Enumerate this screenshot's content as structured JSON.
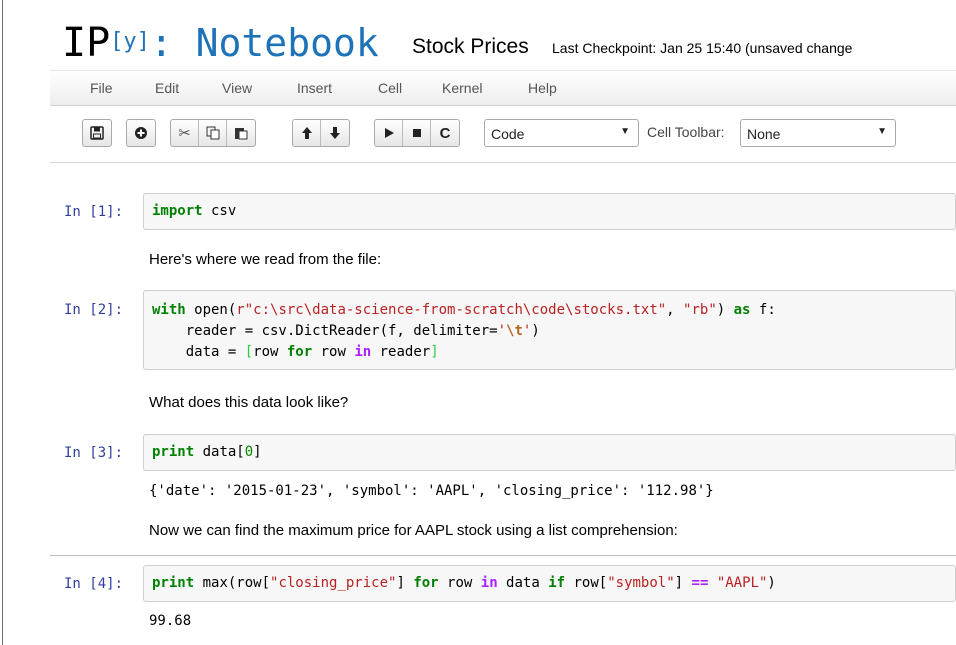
{
  "header": {
    "logo_ip": "IP",
    "logo_y": "[y]",
    "logo_rest": ": Notebook",
    "notebook_title": "Stock Prices",
    "checkpoint": "Last Checkpoint: Jan 25 15:40 (unsaved change"
  },
  "menu": [
    "File",
    "Edit",
    "View",
    "Insert",
    "Cell",
    "Kernel",
    "Help"
  ],
  "toolbar": {
    "icons": [
      "save-icon",
      "plus-icon",
      "cut-icon",
      "copy-icon",
      "paste-icon",
      "arrow-up-icon",
      "arrow-down-icon",
      "play-icon",
      "stop-icon",
      "restart-icon"
    ],
    "cell_type": "Code",
    "cell_toolbar_label": "Cell Toolbar:",
    "cell_toolbar_value": "None"
  },
  "cells": {
    "c1": {
      "prompt": "In [1]:",
      "kw": "import",
      "rest": " csv"
    },
    "md1": "Here's where we read from the file:",
    "c2": {
      "prompt": "In [2]:",
      "l1_with": "with",
      "l1_open": " open(",
      "l1_r": "r",
      "l1_path": "\"c:\\src\\data-science-from-scratch\\code\\stocks.txt\"",
      "l1_comma": ", ",
      "l1_rb": "\"rb\"",
      "l1_close": ") ",
      "l1_as": "as",
      "l1_f": " f:",
      "l2_a": "    reader = csv.DictReader(f, delimiter=",
      "l2_q1": "'",
      "l2_esc": "\\t",
      "l2_q2": "'",
      "l2_b": ")",
      "l3_a": "    data = ",
      "l3_lb": "[",
      "l3_row": "row ",
      "l3_for": "for",
      "l3_row2": " row ",
      "l3_in": "in",
      "l3_reader": " reader",
      "l3_rb": "]"
    },
    "md2": "What does this data look like?",
    "c3": {
      "prompt": "In [3]:",
      "kw": "print",
      "rest": " data[",
      "num": "0",
      "end": "]"
    },
    "out3": "{'date': '2015-01-23', 'symbol': 'AAPL', 'closing_price': '112.98'}",
    "md3": "Now we can find the maximum price for AAPL stock using a list comprehension:",
    "c4": {
      "prompt": "In [4]:",
      "print": "print",
      "a": " max(row[",
      "s1": "\"closing_price\"",
      "b": "] ",
      "for": "for",
      "c": " row ",
      "in": "in",
      "d": " data ",
      "if": "if",
      "e": " row[",
      "s2": "\"symbol\"",
      "f": "] ",
      "eq": "==",
      "g": " ",
      "s3": "\"AAPL\"",
      "h": ")"
    },
    "out4": "99.68"
  }
}
